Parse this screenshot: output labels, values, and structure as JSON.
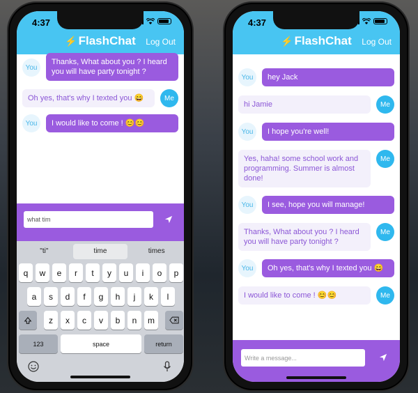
{
  "status": {
    "time": "4:37"
  },
  "app": {
    "title": "FlashChat",
    "logout": "Log Out"
  },
  "left": {
    "messages": [
      {
        "sender": "You",
        "side": "other",
        "text": "Thanks, What about you ? I heard you will have party tonight ?"
      },
      {
        "sender": "Me",
        "side": "user",
        "text": "Oh yes, that's why I texted you 😄"
      },
      {
        "sender": "You",
        "side": "other",
        "text": "I would like to come ! 😊😊"
      }
    ],
    "input_value": "what tim",
    "suggestions": [
      "\"ti\"",
      "time",
      "times"
    ],
    "keys": {
      "row1": [
        "q",
        "w",
        "e",
        "r",
        "t",
        "y",
        "u",
        "i",
        "o",
        "p"
      ],
      "row2": [
        "a",
        "s",
        "d",
        "f",
        "g",
        "h",
        "j",
        "k",
        "l"
      ],
      "row3": [
        "z",
        "x",
        "c",
        "v",
        "b",
        "n",
        "m"
      ],
      "numbers": "123",
      "space": "space",
      "return": "return"
    }
  },
  "right": {
    "messages": [
      {
        "sender": "You",
        "side": "other",
        "text": "hey Jack"
      },
      {
        "sender": "Me",
        "side": "user",
        "text": "hi Jamie"
      },
      {
        "sender": "You",
        "side": "other",
        "text": "I hope you're well!"
      },
      {
        "sender": "Me",
        "side": "user",
        "text": "Yes, haha! some school work and programming. Summer is almost done!"
      },
      {
        "sender": "You",
        "side": "other",
        "text": "I see, hope you will manage!"
      },
      {
        "sender": "Me",
        "side": "user",
        "text": "Thanks, What about you ? I heard you will have party tonight ?"
      },
      {
        "sender": "You",
        "side": "other",
        "text": "Oh yes, that's why I texted you 😄"
      },
      {
        "sender": "Me",
        "side": "user",
        "text": "I would like to come ! 😊😊"
      }
    ],
    "placeholder": "Write a message..."
  },
  "icons": {
    "send": "send-icon",
    "emoji": "emoji-icon",
    "mic": "mic-icon",
    "shift": "shift-icon",
    "backspace": "backspace-icon"
  },
  "colors": {
    "header": "#48c5f2",
    "purple": "#9a5bdf",
    "avatar_me": "#2fb8ee"
  }
}
